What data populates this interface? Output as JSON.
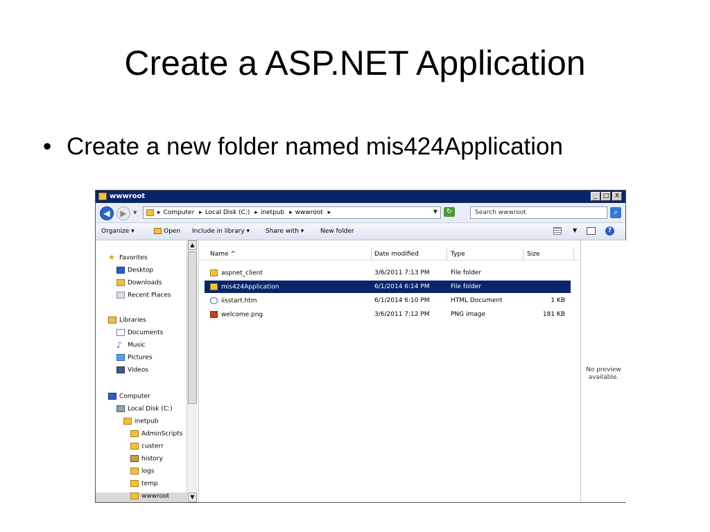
{
  "slide": {
    "title": "Create a ASP.NET Application",
    "bullet_mark": "•",
    "bullet": "Create a new folder named mis424Application"
  },
  "window": {
    "title": "wwwroot",
    "controls": {
      "minimize": "_",
      "maximize": "□",
      "close": "X"
    }
  },
  "address": {
    "breadcrumbs": [
      "Computer",
      "Local Disk (C:)",
      "inetpub",
      "wwwroot"
    ],
    "search_placeholder": "Search wwwroot"
  },
  "toolbar": {
    "organize": "Organize ▾",
    "open": "Open",
    "include": "Include in library ▾",
    "share": "Share with ▾",
    "new_folder": "New folder"
  },
  "nav": {
    "favorites": "Favorites",
    "desktop": "Desktop",
    "downloads": "Downloads",
    "recent": "Recent Places",
    "libraries": "Libraries",
    "documents": "Documents",
    "music": "Music",
    "pictures": "Pictures",
    "videos": "Videos",
    "computer": "Computer",
    "local_disk": "Local Disk (C:)",
    "inetpub": "inetpub",
    "adminscripts": "AdminScripts",
    "custerr": "custerr",
    "history": "history",
    "logs": "logs",
    "temp": "temp",
    "wwwroot": "wwwroot"
  },
  "columns": {
    "name": "Name ^",
    "date": "Date modified",
    "type": "Type",
    "size": "Size"
  },
  "files": [
    {
      "name": "aspnet_client",
      "date": "3/6/2011 7:13 PM",
      "type": "File folder",
      "size": ""
    },
    {
      "name": "mis424Application",
      "date": "6/1/2014 6:14 PM",
      "type": "File folder",
      "size": ""
    },
    {
      "name": "iisstart.htm",
      "date": "6/1/2014 6:10 PM",
      "type": "HTML Document",
      "size": "1 KB"
    },
    {
      "name": "welcome.png",
      "date": "3/6/2011 7:12 PM",
      "type": "PNG image",
      "size": "181 KB"
    }
  ],
  "preview": {
    "line1": "No preview",
    "line2": "available."
  },
  "colors": {
    "title_bar": "#0a246a",
    "selection": "#0a246a"
  },
  "icons": {
    "back": "back-arrow-icon",
    "forward": "forward-arrow-icon",
    "refresh": "refresh-icon",
    "search": "search-icon",
    "help": "help-icon",
    "folder": "folder-icon"
  }
}
